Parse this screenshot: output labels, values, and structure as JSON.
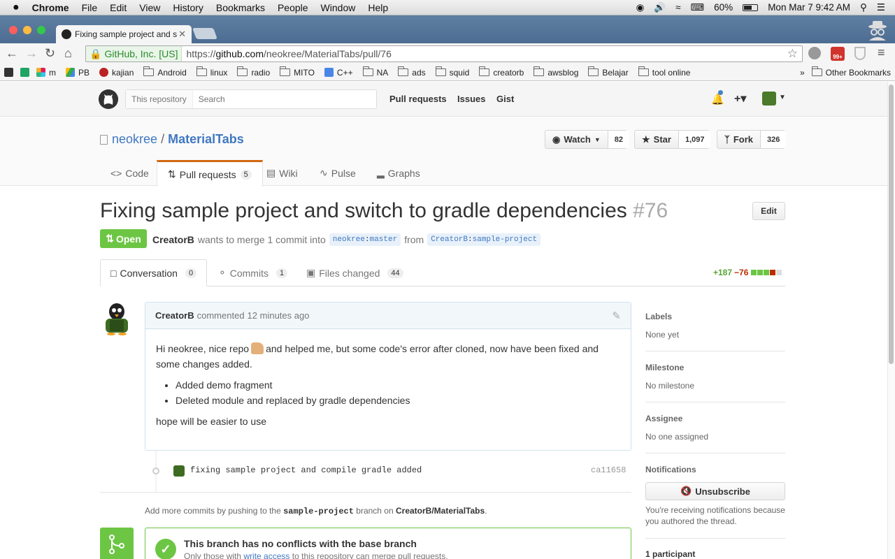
{
  "menubar": {
    "apple": "",
    "app": "Chrome",
    "items": [
      "File",
      "Edit",
      "View",
      "History",
      "Bookmarks",
      "People",
      "Window",
      "Help"
    ],
    "battery": "60%",
    "clock": "Mon Mar 7  9:42 AM"
  },
  "browser": {
    "tab_title": "Fixing sample project and s",
    "secure_label": "GitHub, Inc. [US]",
    "url_scheme": "https://",
    "url_host": "github.com",
    "url_path": "/neokree/MaterialTabs/pull/76",
    "ext_badge": "99+"
  },
  "bookmarks": {
    "items": [
      "m",
      "PB",
      "kajian",
      "Android",
      "linux",
      "radio",
      "MITO",
      "C++",
      "NA",
      "ads",
      "squid",
      "creatorb",
      "awsblog",
      "Belajar",
      "tool online"
    ],
    "overflow": "»",
    "other": "Other Bookmarks"
  },
  "github_header": {
    "scope": "This repository",
    "search_placeholder": "Search",
    "nav": [
      "Pull requests",
      "Issues",
      "Gist"
    ],
    "plus": "+▾"
  },
  "repo": {
    "owner": "neokree",
    "sep": "/",
    "name": "MaterialTabs",
    "watch_label": "Watch",
    "watch_count": "82",
    "star_label": "Star",
    "star_count": "1,097",
    "fork_label": "Fork",
    "fork_count": "326",
    "nav": {
      "code": "Code",
      "pulls": "Pull requests",
      "pulls_count": "5",
      "wiki": "Wiki",
      "pulse": "Pulse",
      "graphs": "Graphs"
    }
  },
  "pr": {
    "title": "Fixing sample project and switch to gradle dependencies",
    "number": "#76",
    "edit": "Edit",
    "state": "Open",
    "author": "CreatorB",
    "merge_text": "wants to merge 1 commit into",
    "base_owner": "neokree",
    "base_branch": "master",
    "from": "from",
    "head_owner": "CreatorB",
    "head_branch": "sample-project",
    "tabs": {
      "conversation": "Conversation",
      "conversation_count": "0",
      "commits": "Commits",
      "commits_count": "1",
      "files": "Files changed",
      "files_count": "44"
    },
    "additions": "+187",
    "deletions": "−76"
  },
  "comment": {
    "author": "CreatorB",
    "action": "commented",
    "time": "12 minutes ago",
    "p1a": "Hi neokree, nice repo",
    "p1b": "and helped me, but some code's error after cloned, now have been fixed and some changes added.",
    "items": [
      "Added demo fragment",
      "Deleted module and replaced by gradle dependencies"
    ],
    "p2": "hope will be easier to use"
  },
  "commit": {
    "message": "fixing sample project and compile gradle added",
    "sha": "ca11658"
  },
  "hint": {
    "pre": "Add more commits by pushing to the",
    "branch": "sample-project",
    "mid": "branch on",
    "repo": "CreatorB/MaterialTabs",
    "end": "."
  },
  "merge": {
    "title": "This branch has no conflicts with the base branch",
    "sub_pre": "Only those with",
    "sub_link": "write access",
    "sub_post": "to this repository can merge pull requests."
  },
  "sidebar": {
    "labels_h": "Labels",
    "labels_v": "None yet",
    "milestone_h": "Milestone",
    "milestone_v": "No milestone",
    "assignee_h": "Assignee",
    "assignee_v": "No one assigned",
    "notifications_h": "Notifications",
    "unsubscribe": "Unsubscribe",
    "notif_note": "You're receiving notifications because you authored the thread.",
    "participants_h": "1 participant"
  },
  "colors": {
    "open_green": "#6cc644",
    "link_blue": "#4078c0",
    "tab_orange": "#d26911",
    "del_red": "#bd2c00"
  }
}
